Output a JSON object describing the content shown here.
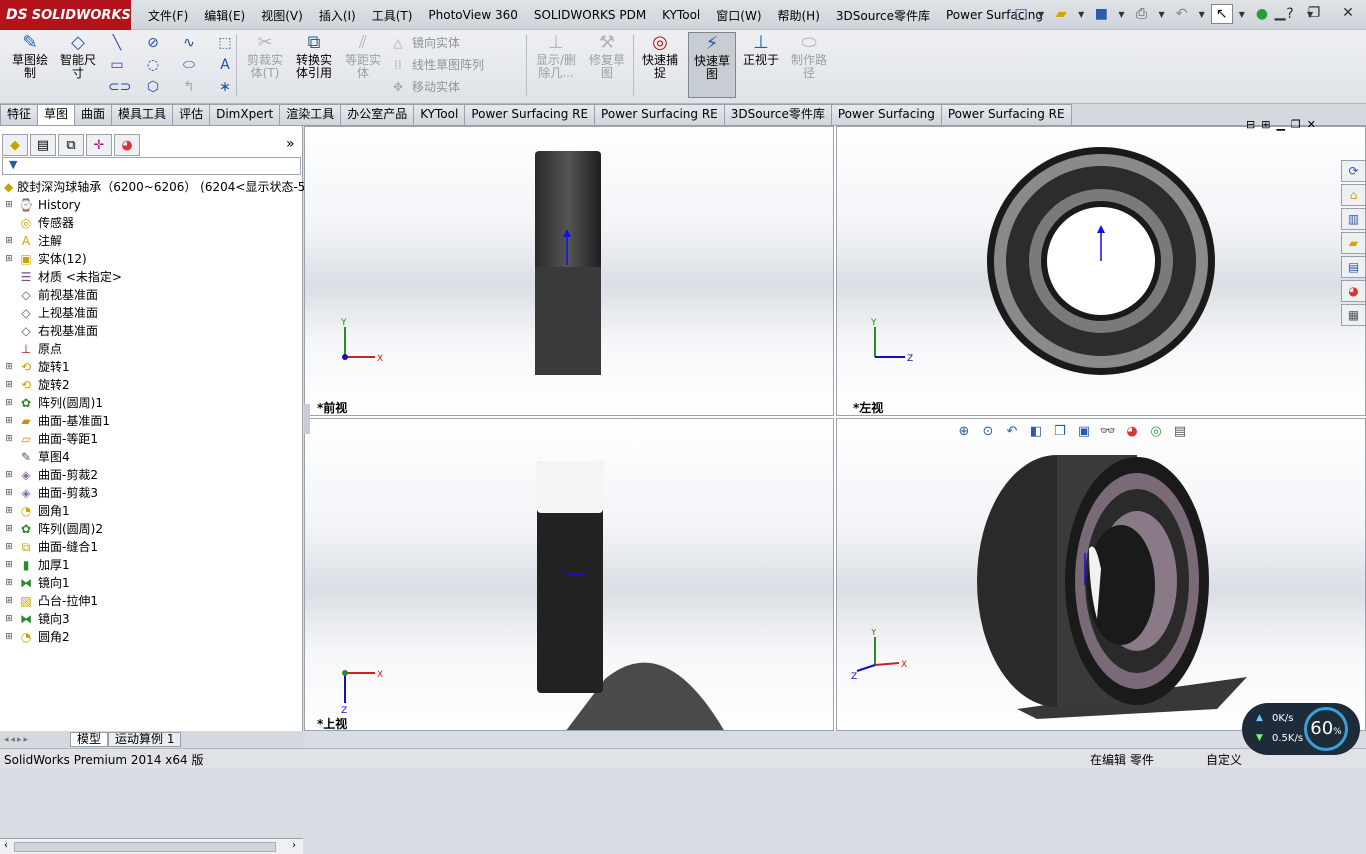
{
  "app": {
    "logo": "SOLIDWORKS",
    "logo_ds": "DS"
  },
  "menu": [
    "文件(F)",
    "编辑(E)",
    "视图(V)",
    "插入(I)",
    "工具(T)",
    "PhotoView 360",
    "SOLIDWORKS PDM",
    "KYTool",
    "窗口(W)",
    "帮助(H)",
    "3DSource零件库",
    "Power Surfacing"
  ],
  "toolbar": {
    "sketch": "草图绘制",
    "smart_dim": "智能尺寸",
    "trim": "剪裁实体(T)",
    "convert": "转换实体引用",
    "offset": "等距实体",
    "mirror": "镜向实体",
    "linear_pattern": "线性草图阵列",
    "move": "移动实体",
    "show_delete": "显示/删除几...",
    "repair": "修复草图",
    "quick_snap": "快速捕捉",
    "rapid_sketch": "快速草图",
    "normal_to": "正视于",
    "make_path": "制作路径"
  },
  "tabs": [
    "特征",
    "草图",
    "曲面",
    "模具工具",
    "评估",
    "DimXpert",
    "渲染工具",
    "办公室产品",
    "KYTool",
    "Power Surfacing RE",
    "Power Surfacing RE",
    "3DSource零件库",
    "Power Surfacing",
    "Power Surfacing RE"
  ],
  "selected_tab_index": 1,
  "tree": {
    "root": "胶封深沟球轴承（6200~6206）  (6204<显示状态-5",
    "items": [
      {
        "label": "History",
        "icon": "history-icon",
        "exp": "+"
      },
      {
        "label": "传感器",
        "icon": "sensor-icon",
        "exp": ""
      },
      {
        "label": "注解",
        "icon": "annotation-icon",
        "exp": "+"
      },
      {
        "label": "实体(12)",
        "icon": "solid-bodies-icon",
        "exp": "+"
      },
      {
        "label": "材质 <未指定>",
        "icon": "material-icon",
        "exp": ""
      },
      {
        "label": "前视基准面",
        "icon": "plane-icon",
        "exp": ""
      },
      {
        "label": "上视基准面",
        "icon": "plane-icon",
        "exp": ""
      },
      {
        "label": "右视基准面",
        "icon": "plane-icon",
        "exp": ""
      },
      {
        "label": "原点",
        "icon": "origin-icon",
        "exp": ""
      },
      {
        "label": "旋转1",
        "icon": "revolve-icon",
        "exp": "+"
      },
      {
        "label": "旋转2",
        "icon": "revolve-icon",
        "exp": "+"
      },
      {
        "label": "阵列(圆周)1",
        "icon": "circular-pattern-icon",
        "exp": "+"
      },
      {
        "label": "曲面-基准面1",
        "icon": "surface-icon",
        "exp": "+"
      },
      {
        "label": "曲面-等距1",
        "icon": "surface-offset-icon",
        "exp": "+"
      },
      {
        "label": "草图4",
        "icon": "sketch-icon",
        "exp": ""
      },
      {
        "label": "曲面-剪裁2",
        "icon": "surface-trim-icon",
        "exp": "+"
      },
      {
        "label": "曲面-剪裁3",
        "icon": "surface-trim-icon",
        "exp": "+"
      },
      {
        "label": "圆角1",
        "icon": "fillet-icon",
        "exp": "+"
      },
      {
        "label": "阵列(圆周)2",
        "icon": "circular-pattern-icon",
        "exp": "+"
      },
      {
        "label": "曲面-缝合1",
        "icon": "knit-icon",
        "exp": "+"
      },
      {
        "label": "加厚1",
        "icon": "thicken-icon",
        "exp": "+"
      },
      {
        "label": "镜向1",
        "icon": "mirror-icon",
        "exp": "+"
      },
      {
        "label": "凸台-拉伸1",
        "icon": "extrude-icon",
        "exp": "+"
      },
      {
        "label": "镜向3",
        "icon": "mirror-icon",
        "exp": "+"
      },
      {
        "label": "圆角2",
        "icon": "fillet-icon",
        "exp": "+"
      }
    ]
  },
  "views": {
    "front": "*前视",
    "left": "*左视",
    "top": "*上视"
  },
  "bottom_tabs": [
    "模型",
    "运动算例 1"
  ],
  "status": {
    "left": "SolidWorks Premium 2014 x64 版",
    "editing": "在编辑 零件",
    "custom": "自定义"
  },
  "network": {
    "up": "0K/s",
    "down": "0.5K/s",
    "percent": "60",
    "unit": "%"
  }
}
